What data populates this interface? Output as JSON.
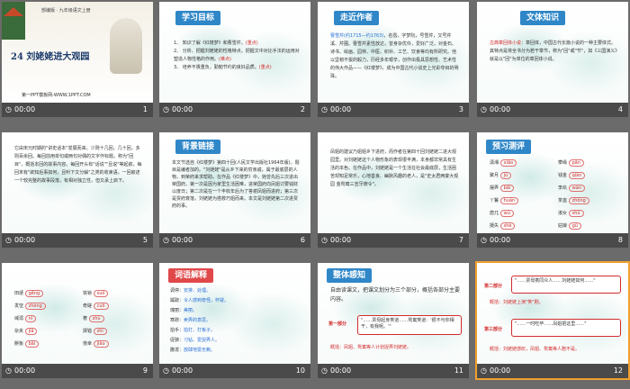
{
  "slides": [
    {
      "number": "1",
      "time": "00:00",
      "header": "部编版 · 九年级语文上册",
      "title": "24 刘姥姥进大观园",
      "footer": "第一PPT模板网-WWW.1PPT.COM"
    },
    {
      "number": "2",
      "time": "00:00",
      "tag": "学习目标",
      "items": [
        {
          "text": "1、 知识了解《红楼梦》和曹雪芹。",
          "mark": "(重点)"
        },
        {
          "text": "2、 分析、把握刘姥姥的性格特点，把握文中对比手法的运用对塑造人物性格的作用。",
          "mark": "(难点)"
        },
        {
          "text": "3、 培养不畏重负，勤勉节约的良好品质。",
          "mark": "(重点)"
        }
      ]
    },
    {
      "number": "3",
      "time": "00:00",
      "tag": "走近作者",
      "lead": "曹雪芹",
      "years": "(约1715—约1763)",
      "text": "，名霑，字梦阮，号雪芹，又号芹溪、芹圃。曹雪芹素性放达，曾身杂优伶，爱好广泛，对金石、诗书、绘画、园林、中医、织补、工艺、饮食等均有所研究。他以坚韧不拔的毅力，历经多年艰辛，创作出极具思想性、艺术性的伟大作品——《红楼梦》，成为中国古代小说史上光彩夺目的明珠。"
    },
    {
      "number": "4",
      "time": "00:00",
      "tag": "文体知识",
      "lead": "古典章回体小说",
      "text": "：章回体，中国古代长篇小说的一种主要体式。其特点是将全书分为若干章节，称为\"回\"或\"节\"，如《三国演义》就是以\"回\"为单位的章回体小说。"
    },
    {
      "number": "5",
      "time": "00:00",
      "text": "它由宋元时期的\"讲史话本\"发展而来。少则十几回，几十回，多则百余回。每回前用单句或两句对偶的文字作标题，称为\"回目\"，概括本回的故事内容。每回开头有\"话说\"\"且说\"等起叙，每回末有\"欲知后事如何，且听下文分解\"之类的收束语。一回叙述一个较完整的故事段落，有相对独立性，但又承上启下。"
    },
    {
      "number": "6",
      "time": "00:00",
      "tag": "背景链接",
      "text": "本文节选自《红楼梦》第四十回(人民文学出版社1964年版)。题目是编者加的。\"刘姥姥\"是从乡下来的穷亲戚，属于最底层的人物，到荣府来求帮助。在作品《红楼梦》中，她曾先后三次进出荣国府。第一次是因为家里生活困难，进荣国府向凤姐讨要钱财以度日；第二次是在一个丰收年后为了答谢凤姐而进府；第三次是贾府衰落，刘姥姥为搭救巧姐而来。本文是刘姥姥第二次进贾府的事。"
    },
    {
      "number": "7",
      "time": "00:00",
      "text": "凤姐的建议乃姐姐乡下进府，而作者在第四十回刘姥姥二进大观园里。对刘姥姥这个人物形象的表现很丰满，本身都非常具有生活的本色。在作品中，刘姥姥是一个生活在社会最底层，生活困苦却知足常乐，心地善良、幽默风趣的老人，是\"史太君两宴大观园  金鸳鸯三宣牙牌令\"。"
    },
    {
      "number": "8",
      "time": "00:00",
      "tag": "预习测评",
      "words": [
        {
          "word": "潇湘",
          "pinyin": "xiāo"
        },
        {
          "word": "攀缘",
          "pinyin": "pān"
        },
        {
          "word": "聚月",
          "pinyin": "jù"
        },
        {
          "word": "钱金",
          "pinyin": "qián"
        },
        {
          "word": "摆弄",
          "pinyin": "bǎi"
        },
        {
          "word": "李纨",
          "pinyin": "wán"
        },
        {
          "word": "丫鬟",
          "pinyin": "huán"
        },
        {
          "word": "茶盅",
          "pinyin": "zhōng"
        },
        {
          "word": "唐兀",
          "pinyin": "wù"
        },
        {
          "word": "淑女",
          "pinyin": "shū"
        },
        {
          "word": "摄失",
          "pinyin": "shè"
        },
        {
          "word": "姑娘",
          "pinyin": "gū"
        }
      ]
    },
    {
      "number": "9",
      "time": "00:00",
      "words": [
        {
          "word": "田埂",
          "pinyin": "gěng"
        },
        {
          "word": "铁锁",
          "pinyin": "suǒ"
        },
        {
          "word": "发怔",
          "pinyin": "zhèng"
        },
        {
          "word": "奇磋",
          "pinyin": "cuō"
        },
        {
          "word": "缄溺",
          "pinyin": "nì"
        },
        {
          "word": "箸",
          "pinyin": "zhù"
        },
        {
          "word": "杂夹",
          "pinyin": "jiā"
        },
        {
          "word": "掷错",
          "pinyin": "zhì"
        },
        {
          "word": "掰板",
          "pinyin": "bāi"
        },
        {
          "word": "侥幸",
          "pinyin": "jiǎo"
        }
      ]
    },
    {
      "number": "10",
      "time": "00:00",
      "tag": "词语解释",
      "entries": [
        {
          "term": "调停：",
          "def": "安排、处理。"
        },
        {
          "term": "蹊跷：",
          "def": "令人感到奇怪，怀疑。"
        },
        {
          "term": "瑰丽：",
          "def": "美丽。"
        },
        {
          "term": "寒碜：",
          "def": "卖弄的意思。"
        },
        {
          "term": "拍手：",
          "def": "拍打、打板子。"
        },
        {
          "term": "促狭：",
          "def": "刁钻、爱捉弄人。"
        },
        {
          "term": "撒泼：",
          "def": "放肆地耍无赖。"
        }
      ]
    },
    {
      "number": "11",
      "time": "00:00",
      "tag": "整体感知",
      "intro": "自由读课文，把课文划分为三个部分，概括各部分主要内容。",
      "part_label": "第一部分",
      "part_quote": "\"……贾母起身笑道……鸳鸯笑道：'很不与你相干，有我呢。'\"",
      "summary": "概括：凤姐、鸳鸯等人计划捉弄刘姥姥。"
    },
    {
      "number": "12",
      "time": "00:00",
      "part2_label": "第二部分",
      "part2_quote": "\"……贾母携同众人……刘姥姥如何……\"",
      "part2_summary": "概括：刘姥姥上演\"笑\"剧。",
      "part3_label": "第三部分",
      "part3_quote": "\"……一时吃毕……凤姐把这里……\"",
      "part3_summary": "概括：刘姥姥感叹，凤姐、鸳鸯等人赔不是。"
    }
  ]
}
